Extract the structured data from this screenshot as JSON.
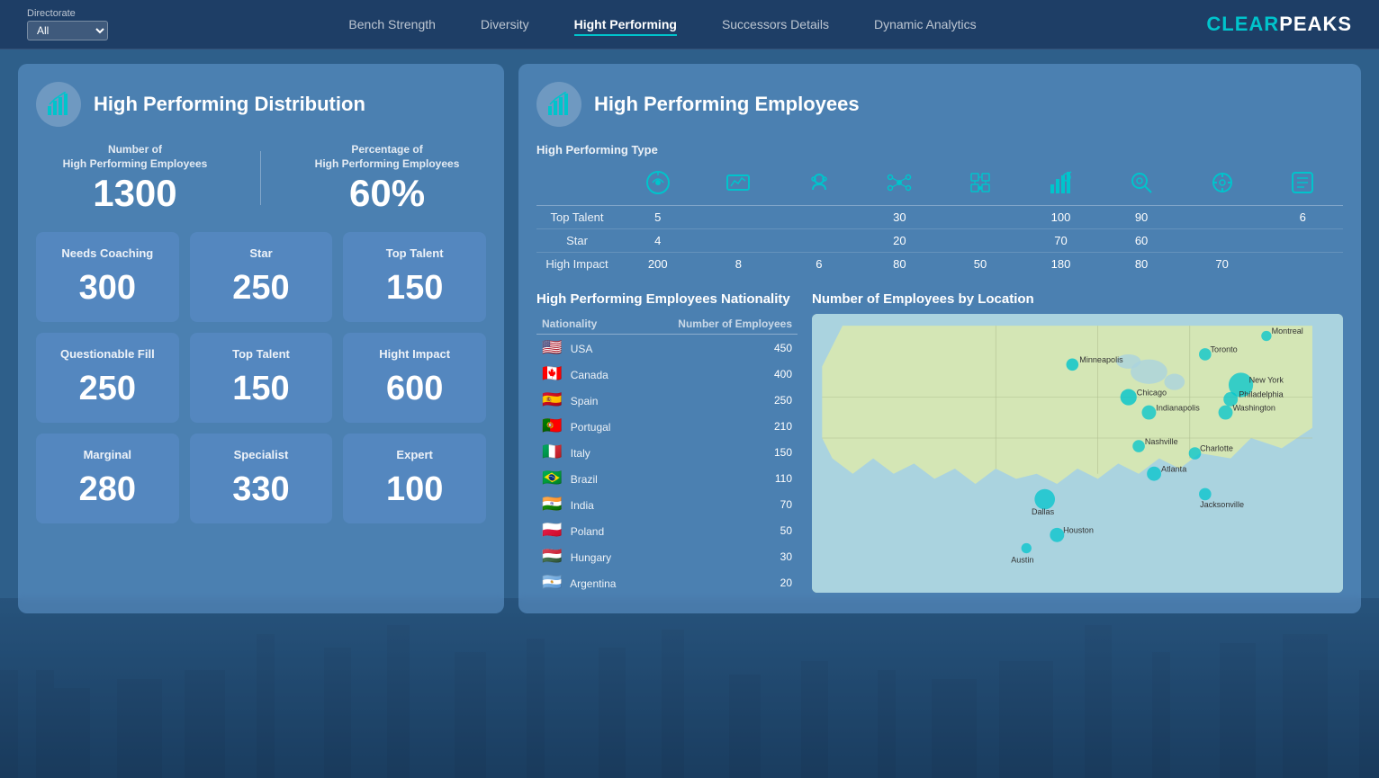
{
  "navbar": {
    "directorate_label": "Directorate",
    "directorate_value": "All",
    "nav_items": [
      {
        "label": "Bench Strength",
        "active": false
      },
      {
        "label": "Diversity",
        "active": false
      },
      {
        "label": "Hight Performing",
        "active": true
      },
      {
        "label": "Successors Details",
        "active": false
      },
      {
        "label": "Dynamic Analytics",
        "active": false
      }
    ],
    "brand_clear": "CLEAR",
    "brand_peaks": "PEAKS"
  },
  "left_panel": {
    "title": "High Performing Distribution",
    "stats": {
      "count_label_line1": "Number of",
      "count_label_line2": "High Performing Employees",
      "count_value": "1300",
      "pct_label_line1": "Percentage of",
      "pct_label_line2": "High Performing Employees",
      "pct_value": "60%"
    },
    "metrics": [
      {
        "label": "Needs Coaching",
        "value": "300"
      },
      {
        "label": "Star",
        "value": "250"
      },
      {
        "label": "Top Talent",
        "value": "150"
      },
      {
        "label": "Questionable Fill",
        "value": "250"
      },
      {
        "label": "Top Talent",
        "value": "150"
      },
      {
        "label": "Hight Impact",
        "value": "600"
      },
      {
        "label": "Marginal",
        "value": "280"
      },
      {
        "label": "Specialist",
        "value": "330"
      },
      {
        "label": "Expert",
        "value": "100"
      }
    ]
  },
  "right_panel": {
    "title": "High Performing Employees",
    "hp_type_label": "High Performing Type",
    "icon_headers": [
      "🔄",
      "📊",
      "🎧",
      "🔗",
      "⚙️",
      "📈",
      "🔍",
      "⚙️",
      "📋"
    ],
    "table_rows": [
      {
        "label": "Top Talent",
        "values": [
          "5",
          "",
          "",
          "30",
          "",
          "100",
          "90",
          "",
          "6"
        ]
      },
      {
        "label": "Star",
        "values": [
          "4",
          "",
          "",
          "20",
          "",
          "70",
          "60",
          "",
          ""
        ]
      },
      {
        "label": "High Impact",
        "values": [
          "200",
          "8",
          "6",
          "80",
          "50",
          "180",
          "80",
          "70",
          ""
        ]
      }
    ],
    "nationality_title": "High Performing Employees Nationality",
    "nationality_col1": "Nationality",
    "nationality_col2": "Number of Employees",
    "nationalities": [
      {
        "flag": "🇺🇸",
        "name": "USA",
        "count": "450"
      },
      {
        "flag": "🇨🇦",
        "name": "Canada",
        "count": "400"
      },
      {
        "flag": "🇪🇸",
        "name": "Spain",
        "count": "250"
      },
      {
        "flag": "🇵🇹",
        "name": "Portugal",
        "count": "210"
      },
      {
        "flag": "🇮🇹",
        "name": "Italy",
        "count": "150"
      },
      {
        "flag": "🇧🇷",
        "name": "Brazil",
        "count": "110"
      },
      {
        "flag": "🇮🇳",
        "name": "India",
        "count": "70"
      },
      {
        "flag": "🇵🇱",
        "name": "Poland",
        "count": "50"
      },
      {
        "flag": "🇭🇺",
        "name": "Hungary",
        "count": "30"
      },
      {
        "flag": "🇦🇷",
        "name": "Argentina",
        "count": "20"
      }
    ],
    "map_title": "Number of Employees by Location"
  }
}
